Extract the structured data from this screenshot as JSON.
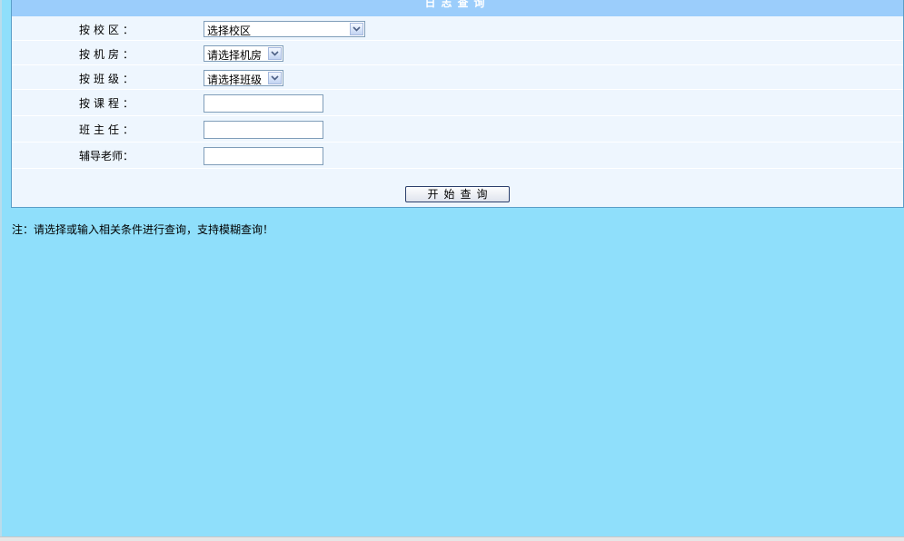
{
  "panel": {
    "title": "日志查询"
  },
  "form": {
    "campus": {
      "label": "按校区：",
      "selected": "选择校区"
    },
    "room": {
      "label": "按机房：",
      "selected": "请选择机房"
    },
    "class": {
      "label": "按班级：",
      "selected": "请选择班级"
    },
    "course": {
      "label": "按课程：",
      "value": ""
    },
    "head_teacher": {
      "label": "班主任：",
      "value": ""
    },
    "tutor": {
      "label": "辅导老师：",
      "value": ""
    },
    "submit_label": "开始查询"
  },
  "note": "注：请选择或输入相关条件进行查询，支持模糊查询！",
  "colors": {
    "background": "#8fdffb",
    "header": "#9bcdfb",
    "panel": "#eef6fe",
    "border": "#5a9ec8"
  }
}
